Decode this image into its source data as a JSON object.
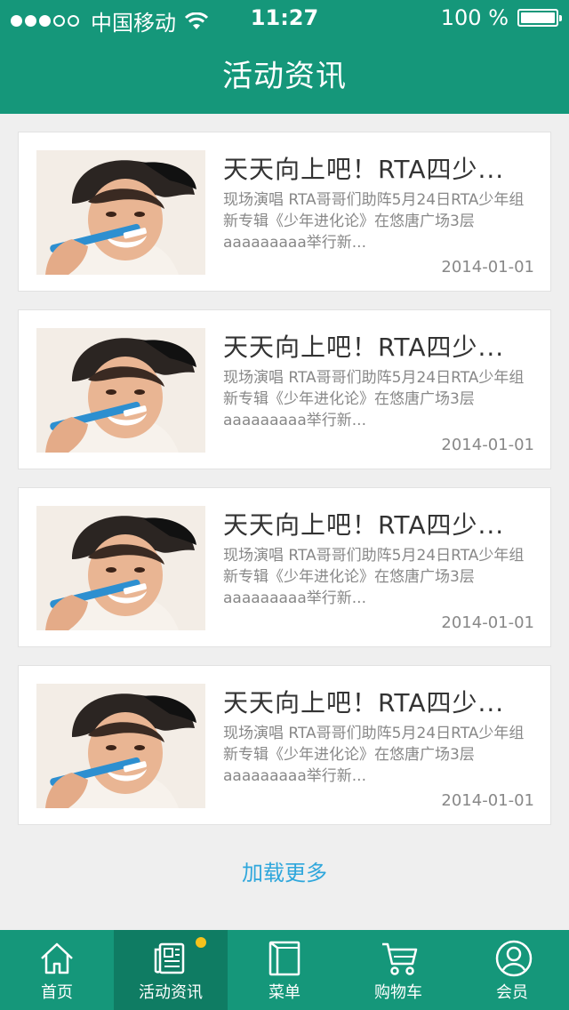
{
  "status_bar": {
    "carrier": "中国移动",
    "time": "11:27",
    "battery": "100 %"
  },
  "header": {
    "title": "活动资讯"
  },
  "articles": [
    {
      "title": "天天向上吧！RTA四少...",
      "desc": "现场演唱 RTA哥哥们助阵5月24日RTA少年组新专辑《少年进化论》在悠唐广场3层aaaaaaaaa举行新...",
      "date": "2014-01-01"
    },
    {
      "title": "天天向上吧！RTA四少...",
      "desc": "现场演唱 RTA哥哥们助阵5月24日RTA少年组新专辑《少年进化论》在悠唐广场3层aaaaaaaaa举行新...",
      "date": "2014-01-01"
    },
    {
      "title": "天天向上吧！RTA四少...",
      "desc": "现场演唱 RTA哥哥们助阵5月24日RTA少年组新专辑《少年进化论》在悠唐广场3层aaaaaaaaa举行新...",
      "date": "2014-01-01"
    },
    {
      "title": "天天向上吧！RTA四少...",
      "desc": "现场演唱 RTA哥哥们助阵5月24日RTA少年组新专辑《少年进化论》在悠唐广场3层aaaaaaaaa举行新...",
      "date": "2014-01-01"
    }
  ],
  "load_more": "加载更多",
  "tabbar": {
    "items": [
      {
        "label": "首页",
        "icon": "home-icon"
      },
      {
        "label": "活动资讯",
        "icon": "news-icon",
        "active": true
      },
      {
        "label": "菜单",
        "icon": "menu-book-icon"
      },
      {
        "label": "购物车",
        "icon": "cart-icon"
      },
      {
        "label": "会员",
        "icon": "member-icon"
      }
    ]
  },
  "colors": {
    "brand": "#15977a",
    "tab_active": "#0f7c63",
    "link": "#2fa7dc",
    "badge": "#f6c21c"
  }
}
